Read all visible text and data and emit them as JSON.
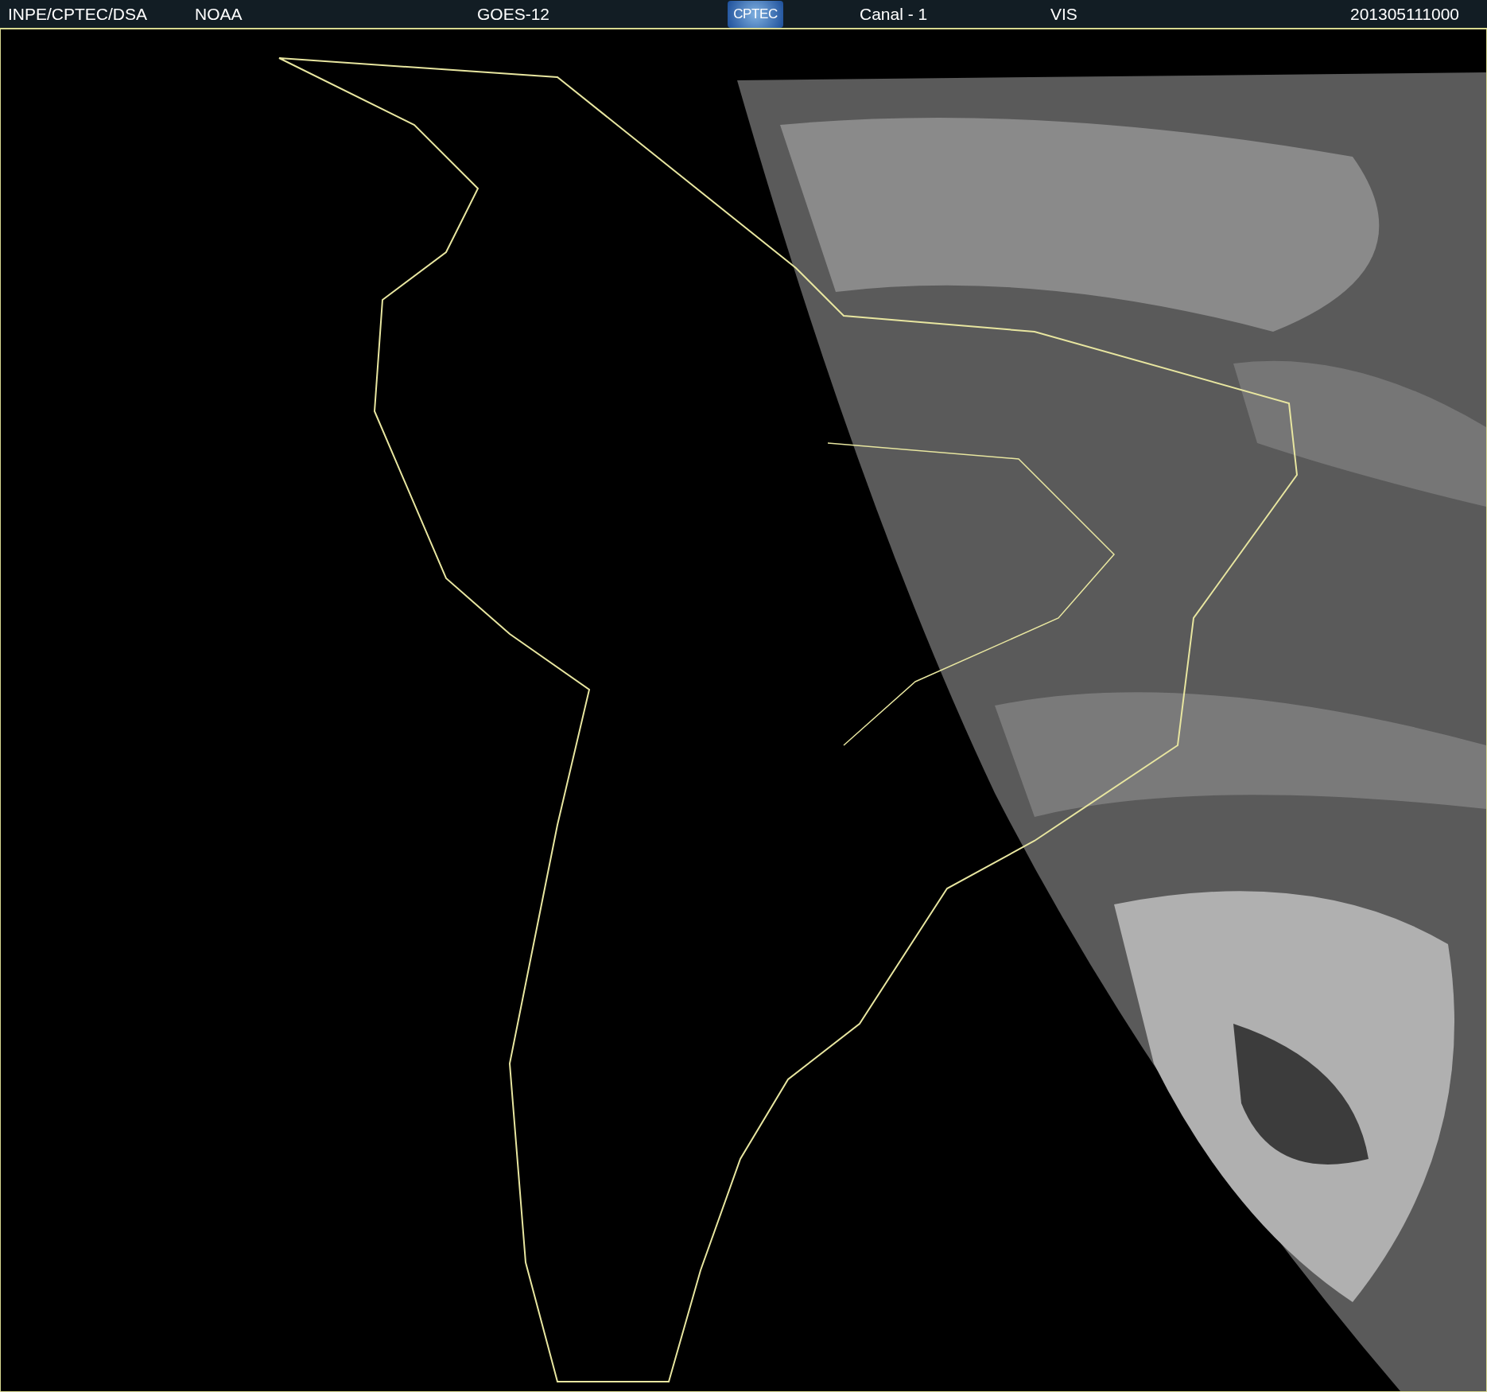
{
  "header": {
    "source": "INPE/CPTEC/DSA",
    "agency": "NOAA",
    "satellite": "GOES-12",
    "logo": "CPTEC",
    "channel": "Canal - 1",
    "band": "VIS",
    "timestamp": "201305111000"
  }
}
